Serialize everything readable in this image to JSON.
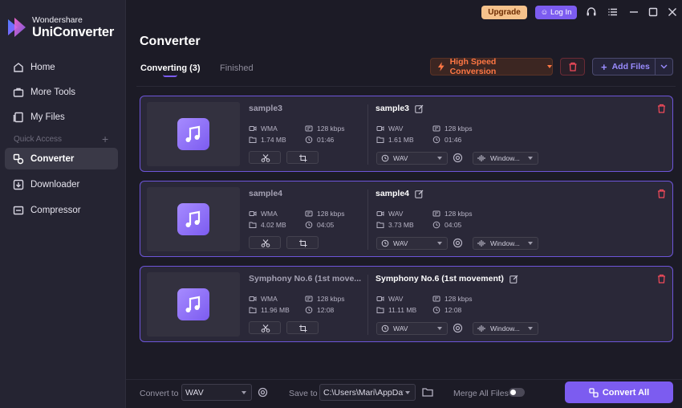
{
  "app": {
    "brand_small": "Wondershare",
    "brand_big": "UniConverter",
    "accent": "#7c5cf0"
  },
  "topbar": {
    "upgrade": "Upgrade",
    "login": "Log In",
    "icons": [
      "headset-icon",
      "menu-icon",
      "minimize-icon",
      "maximize-icon",
      "close-icon"
    ]
  },
  "sidebar": {
    "items": [
      {
        "label": "Home",
        "icon": "home-icon"
      },
      {
        "label": "More Tools",
        "icon": "toolbox-icon"
      },
      {
        "label": "My Files",
        "icon": "files-icon"
      },
      {
        "label": "Converter",
        "icon": "converter-icon",
        "active": true
      },
      {
        "label": "Downloader",
        "icon": "download-icon"
      },
      {
        "label": "Compressor",
        "icon": "compress-icon"
      }
    ],
    "quick_access": "Quick Access"
  },
  "header": {
    "title": "Converter",
    "tabs": [
      {
        "label": "Converting (3)",
        "active": true
      },
      {
        "label": "Finished",
        "active": false
      }
    ],
    "high_speed": "High Speed Conversion",
    "add_files": "Add Files"
  },
  "files": [
    {
      "src_name": "sample3",
      "src_format": "WMA",
      "src_bitrate": "128 kbps",
      "src_size": "1.74 MB",
      "src_duration": "01:46",
      "dst_name": "sample3",
      "dst_format": "WAV",
      "dst_bitrate": "128 kbps",
      "dst_size": "1.61 MB",
      "dst_duration": "01:46",
      "format_select": "WAV",
      "device_select": "Window..."
    },
    {
      "src_name": "sample4",
      "src_format": "WMA",
      "src_bitrate": "128 kbps",
      "src_size": "4.02 MB",
      "src_duration": "04:05",
      "dst_name": "sample4",
      "dst_format": "WAV",
      "dst_bitrate": "128 kbps",
      "dst_size": "3.73 MB",
      "dst_duration": "04:05",
      "format_select": "WAV",
      "device_select": "Window..."
    },
    {
      "src_name": "Symphony No.6 (1st move...",
      "src_format": "WMA",
      "src_bitrate": "128 kbps",
      "src_size": "11.96 MB",
      "src_duration": "12:08",
      "dst_name": "Symphony No.6 (1st movement)",
      "dst_format": "WAV",
      "dst_bitrate": "128 kbps",
      "dst_size": "11.11 MB",
      "dst_duration": "12:08",
      "format_select": "WAV",
      "device_select": "Window..."
    }
  ],
  "bottom": {
    "convert_to_label": "Convert to",
    "convert_to_value": "WAV",
    "save_to_label": "Save to",
    "save_to_value": "C:\\Users\\Mari\\AppData",
    "merge_label": "Merge All Files",
    "merge_on": false,
    "convert_all": "Convert All"
  }
}
